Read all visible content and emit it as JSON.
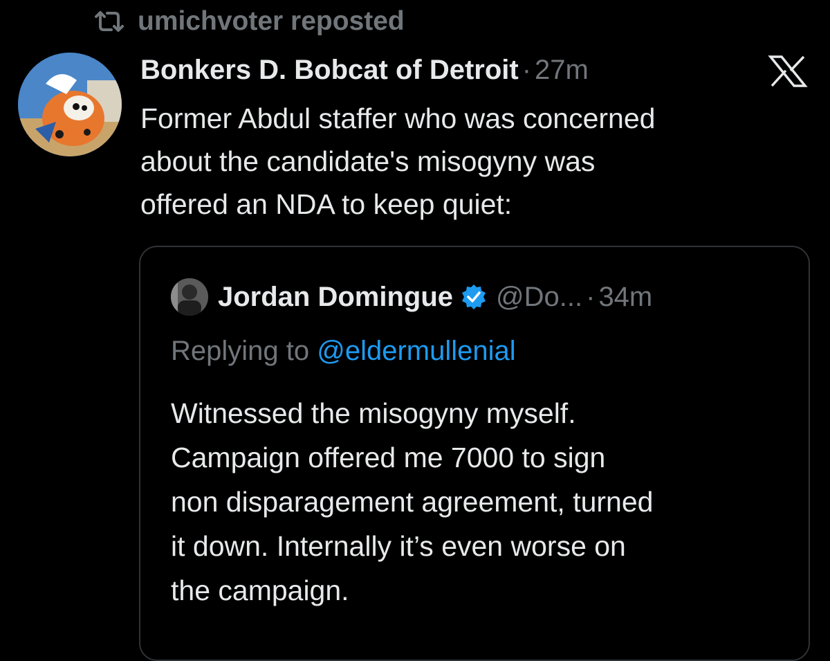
{
  "repost": {
    "icon": "repost-icon",
    "label": "umichvoter reposted"
  },
  "tweet": {
    "author_name": "Bonkers D. Bobcat of Detroit",
    "separator": "·",
    "time": "27m",
    "platform_icon": "x-logo-icon",
    "text": "Former Abdul staffer who was concerned\nabout the candidate's misogyny was\noffered an NDA to keep quiet:"
  },
  "quote": {
    "author_name": "Jordan Domingue",
    "verified_icon": "verified-badge-icon",
    "handle": "@Do...",
    "separator": "·",
    "time": "34m",
    "reply_prefix": "Replying to ",
    "reply_mention": "@eldermullenial",
    "text": "Witnessed the misogyny myself.\nCampaign offered me 7000 to sign\nnon disparagement agreement, turned\nit down. Internally it’s even worse on\nthe campaign."
  },
  "colors": {
    "background": "#000000",
    "text_primary": "#e7e9ea",
    "text_secondary": "#71767b",
    "link": "#1d9bf0",
    "border": "#2f3336"
  }
}
